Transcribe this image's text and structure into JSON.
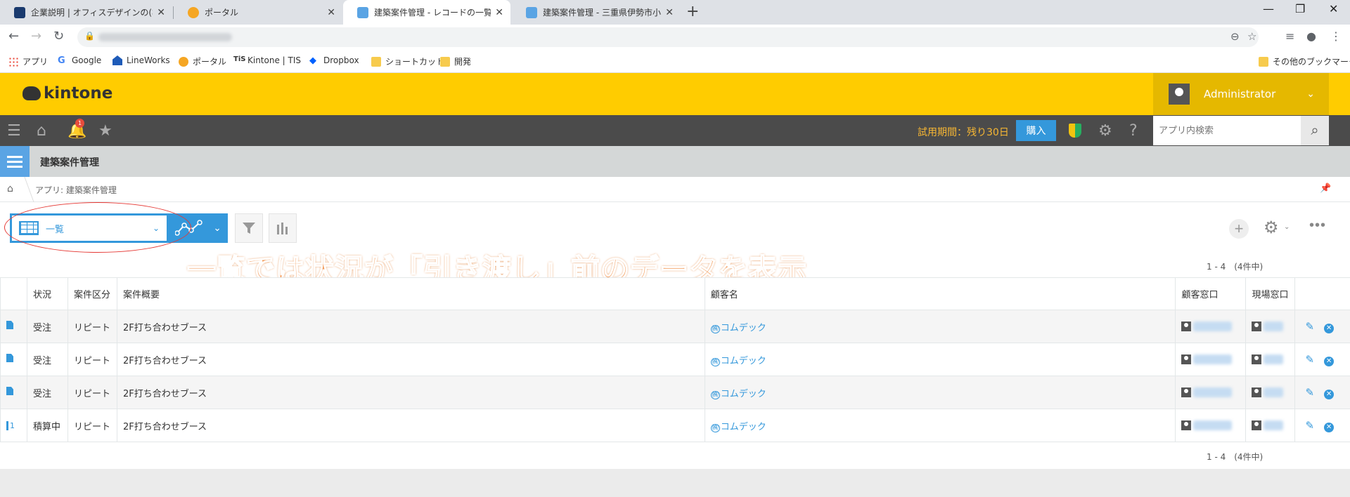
{
  "browser": {
    "tabs": [
      {
        "label": "企業説明 | オフィスデザインの(株)ステ"
      },
      {
        "label": "ポータル"
      },
      {
        "label": "建築案件管理 - レコードの一覧"
      },
      {
        "label": "建築案件管理 - 三重県伊勢市小"
      }
    ],
    "bookmarks": [
      "アプリ",
      "Google",
      "LineWorks",
      "ポータル",
      "Kintone | TIS",
      "Dropbox",
      "ショートカット",
      "開発"
    ],
    "other_bookmarks": "その他のブックマーク"
  },
  "kintone": {
    "logo": "kintone",
    "user": "Administrator",
    "notification_count": "1",
    "trial_text": "試用期間：残り30日",
    "buy_label": "購入",
    "search_placeholder": "アプリ内検索",
    "app_title": "建築案件管理",
    "breadcrumb": "アプリ: 建築案件管理"
  },
  "view": {
    "selected": "一覧",
    "annotation": "一覧では状況が「引き渡し」前のデータを表示",
    "pager_top": "1 - 4　(4件中)",
    "pager_bottom": "1 - 4　(4件中)"
  },
  "table": {
    "headers": [
      "状況",
      "案件区分",
      "案件概要",
      "顧客名",
      "顧客窓口",
      "現場窓口"
    ],
    "rows": [
      {
        "status": "受注",
        "category": "リピート",
        "summary": "2F打ち合わせブース",
        "customer_prefix": "㈱",
        "customer": "コムデック",
        "draft": ""
      },
      {
        "status": "受注",
        "category": "リピート",
        "summary": "2F打ち合わせブース",
        "customer_prefix": "㈱",
        "customer": "コムデック",
        "draft": ""
      },
      {
        "status": "受注",
        "category": "リピート",
        "summary": "2F打ち合わせブース",
        "customer_prefix": "㈱",
        "customer": "コムデック",
        "draft": ""
      },
      {
        "status": "積算中",
        "category": "リピート",
        "summary": "2F打ち合わせブース",
        "customer_prefix": "㈱",
        "customer": "コムデック",
        "draft": "1"
      }
    ]
  }
}
